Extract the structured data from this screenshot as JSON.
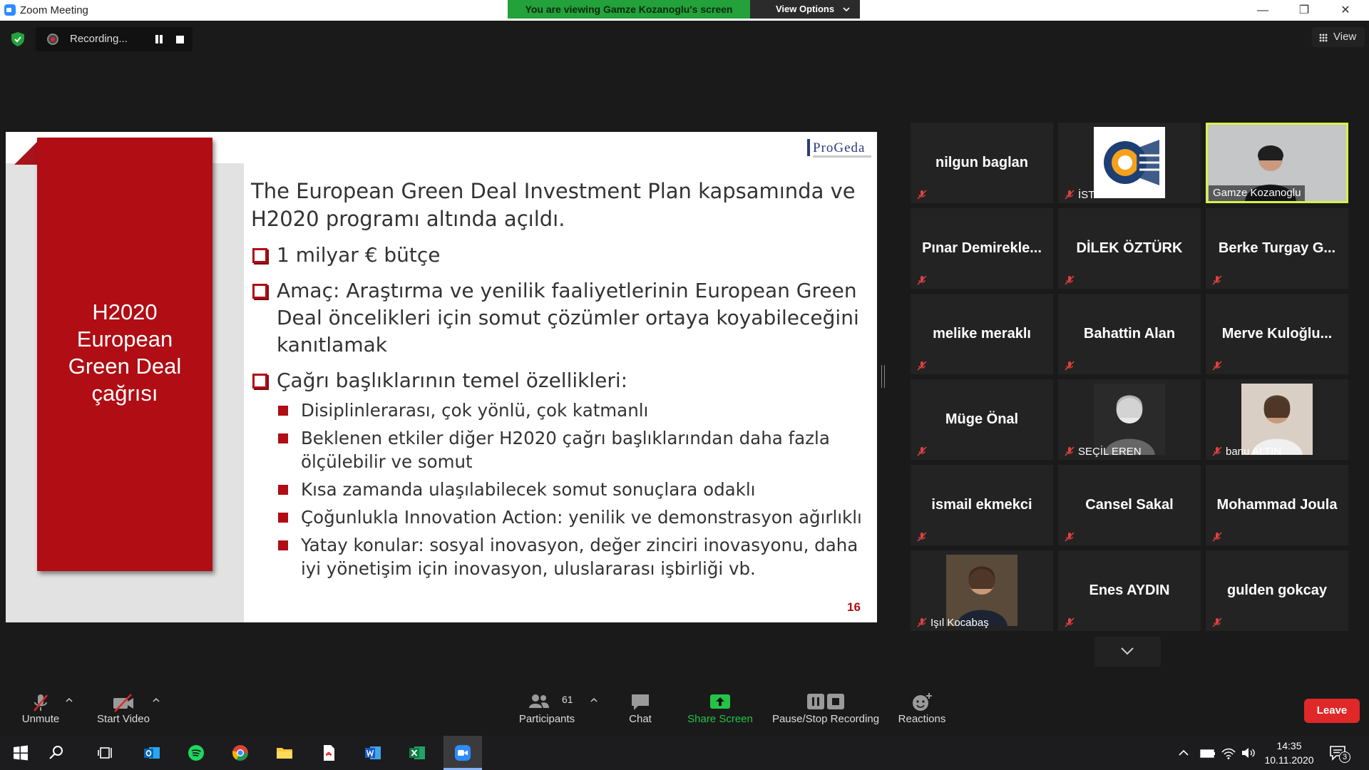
{
  "window": {
    "title": "Zoom Meeting",
    "minimize": "—",
    "restore": "❐",
    "close": "✕"
  },
  "share": {
    "viewing_text": "You are viewing Gamze Kozanoglu's screen",
    "view_options_label": "View Options"
  },
  "recording": {
    "label": "Recording..."
  },
  "view_button": {
    "label": "View"
  },
  "slide": {
    "left_title": [
      "H2020",
      "European",
      "Green Deal",
      "çağrısı"
    ],
    "logo": "ProGeda",
    "intro": "The European Green Deal Investment Plan kapsamında ve H2020 programı altında açıldı.",
    "bullets": [
      "1 milyar € bütçe",
      "Amaç: Araştırma ve yenilik faaliyetlerinin European Green Deal öncelikleri için somut çözümler ortaya koyabileceğini kanıtlamak",
      "Çağrı başlıklarının temel özellikleri:"
    ],
    "sub_bullets": [
      "Disiplinlerarası, çok yönlü, çok katmanlı",
      "Beklenen etkiler diğer H2020 çağrı başlıklarından daha fazla ölçülebilir ve somut",
      "Kısa zamanda ulaşılabilecek somut sonuçlara odaklı",
      "Çoğunlukla Innovation Action: yenilik ve demonstrasyon ağırlıklı",
      "Yatay konular: sosyal inovasyon, değer zinciri inovasyonu, daha iyi yönetişim için inovasyon, uluslararası işbirliği vb."
    ],
    "page_number": "16"
  },
  "participants_grid": [
    {
      "name": "nilgun baglan",
      "type": "name"
    },
    {
      "name": "İSTKA",
      "type": "logo"
    },
    {
      "name": "Gamze Kozanoglu",
      "type": "video"
    },
    {
      "name": "Pınar  Demirekle...",
      "type": "name"
    },
    {
      "name": "DİLEK ÖZTÜRK",
      "type": "name"
    },
    {
      "name": "Berke Turgay G...",
      "type": "name"
    },
    {
      "name": "melike meraklı",
      "type": "name"
    },
    {
      "name": "Bahattin Alan",
      "type": "name"
    },
    {
      "name": "Merve  Kuloğlu...",
      "type": "name"
    },
    {
      "name": "Müge Önal",
      "type": "name"
    },
    {
      "name": "SEÇİL EREN",
      "type": "photo"
    },
    {
      "name": "banu ALTIN",
      "type": "photo"
    },
    {
      "name": "ismail ekmekci",
      "type": "name"
    },
    {
      "name": "Cansel Sakal",
      "type": "name"
    },
    {
      "name": "Mohammad Joula",
      "type": "name"
    },
    {
      "name": "Işıl Kocabaş",
      "type": "photo"
    },
    {
      "name": "Enes AYDIN",
      "type": "name"
    },
    {
      "name": "gulden gokcay",
      "type": "name"
    }
  ],
  "toolbar": {
    "unmute": "Unmute",
    "start_video": "Start Video",
    "participants": "Participants",
    "participants_count": "61",
    "chat": "Chat",
    "share_screen": "Share Screen",
    "pause_stop_recording": "Pause/Stop Recording",
    "reactions": "Reactions",
    "leave": "Leave"
  },
  "taskbar": {
    "time": "14:35",
    "date": "10.11.2020",
    "notification_count": "3",
    "apps": [
      "windows-start",
      "search",
      "task-view",
      "outlook",
      "spotify",
      "chrome",
      "file-explorer",
      "pdf-reader",
      "word",
      "excel",
      "zoom"
    ]
  },
  "colors": {
    "accent_green": "#23a13b",
    "slide_red": "#b00d14",
    "active_speaker": "#d6f24a",
    "leave_red": "#e02828"
  }
}
